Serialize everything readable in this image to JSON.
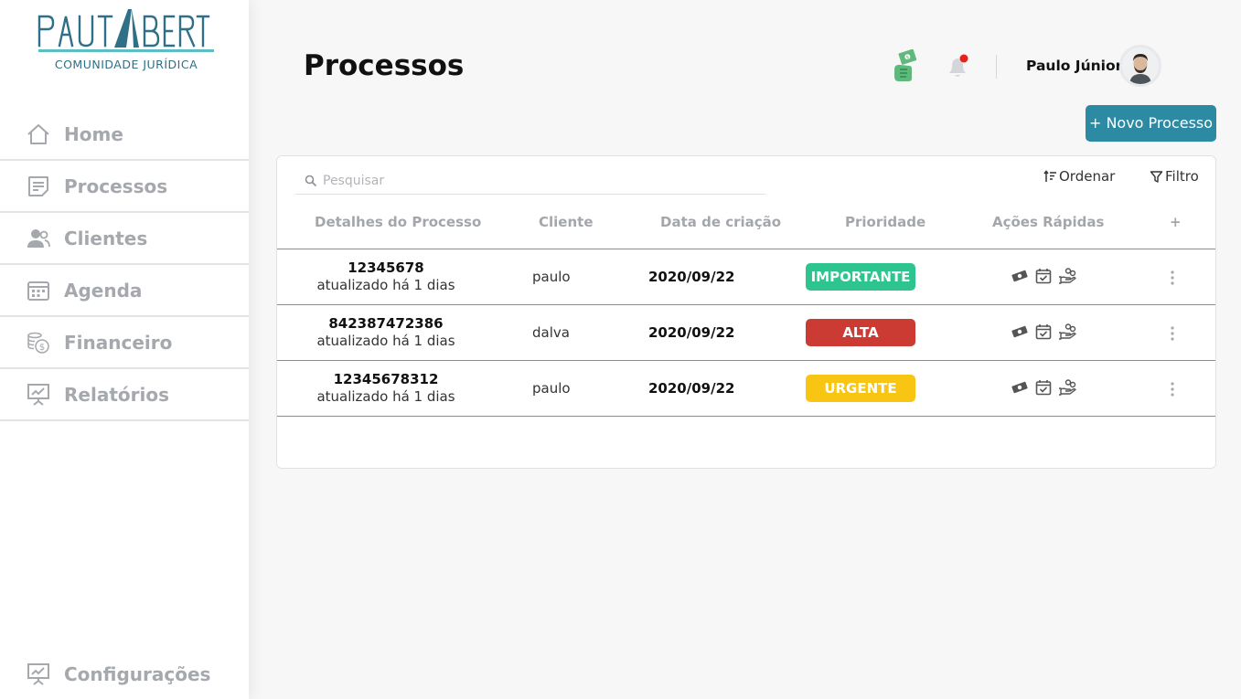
{
  "brand": {
    "wordmark": "PAUTABERTA",
    "subtitle": "COMUNIDADE JURÍDICA",
    "color": "#2f6f87",
    "accent": "#5bbfc2"
  },
  "sidebar": {
    "items": [
      {
        "label": "Home",
        "icon": "home-icon"
      },
      {
        "label": "Processos",
        "icon": "document-icon"
      },
      {
        "label": "Clientes",
        "icon": "users-icon"
      },
      {
        "label": "Agenda",
        "icon": "calendar-icon"
      },
      {
        "label": "Financeiro",
        "icon": "coins-icon"
      },
      {
        "label": "Relatórios",
        "icon": "presentation-icon"
      }
    ],
    "settings": {
      "label": "Configurações",
      "icon": "presentation-icon"
    }
  },
  "header": {
    "title": "Processos",
    "user_name": "Paulo Júnior",
    "new_button_label": "+ Novo Processo"
  },
  "toolbar": {
    "search_placeholder": "Pesquisar",
    "sort_label": "Ordenar",
    "filter_label": "Filtro"
  },
  "table": {
    "columns": [
      "Detalhes do Processo",
      "Cliente",
      "Data de criação",
      "Prioridade",
      "Ações Rápidas",
      "+"
    ],
    "rows": [
      {
        "number": "12345678",
        "updated": "atualizado há 1 dias",
        "client": "paulo",
        "date": "2020/09/22",
        "priority": "IMPORTANTE",
        "priority_color": "#2ec490"
      },
      {
        "number": "842387472386",
        "updated": "atualizado há 1 dias",
        "client": "dalva",
        "date": "2020/09/22",
        "priority": "ALTA",
        "priority_color": "#cc3a34"
      },
      {
        "number": "12345678312",
        "updated": "atualizado há 1 dias",
        "client": "paulo",
        "date": "2020/09/22",
        "priority": "URGENTE",
        "priority_color": "#f9c513"
      }
    ]
  },
  "colors": {
    "primary_button": "#2c8aa3",
    "notification_dot": "#e8201a",
    "money_icon": "#5fb97c"
  }
}
